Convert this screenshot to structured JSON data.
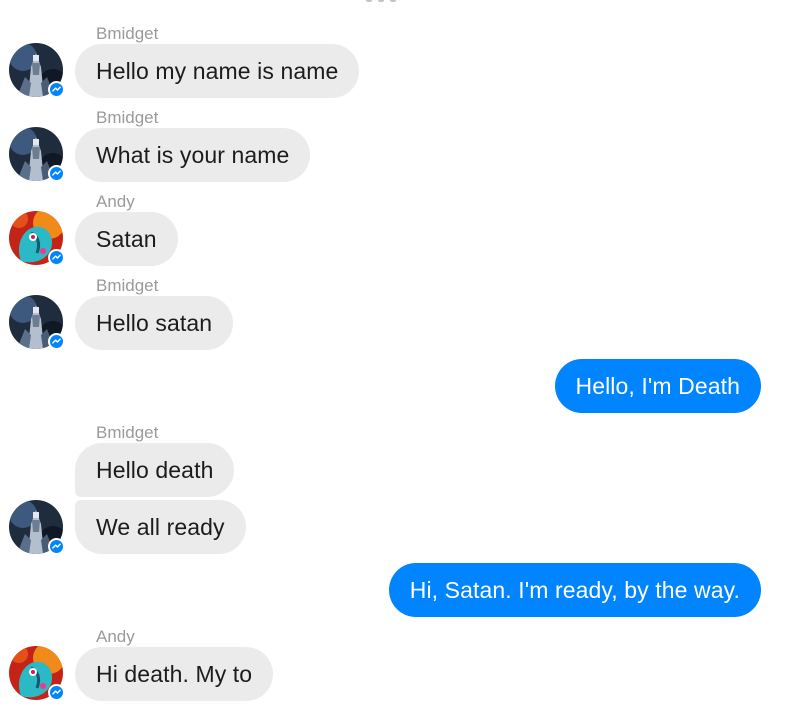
{
  "conversation": {
    "messages": [
      {
        "sender": "Bmidget",
        "text": "Hello my name is name"
      },
      {
        "sender": "Bmidget",
        "text": "What is your name"
      },
      {
        "sender": "Andy",
        "text": "Satan"
      },
      {
        "sender": "Bmidget",
        "text": "Hello satan"
      },
      {
        "sender": "",
        "text": "Hello, I'm Death"
      },
      {
        "sender": "Bmidget",
        "text": "Hello death"
      },
      {
        "sender": "",
        "text": "We all ready"
      },
      {
        "sender": "",
        "text": "Hi, Satan. I'm ready, by the way."
      },
      {
        "sender": "Andy",
        "text": "Hi death. My to"
      }
    ]
  },
  "icons": {
    "avatar_bmidget": "dark-armored-figure-avatar",
    "avatar_andy": "red-fire-creature-avatar",
    "badge": "messenger-badge-icon"
  },
  "colors": {
    "outgoing_bubble": "#0084ff",
    "incoming_bubble": "#ebebeb",
    "sender_name": "#9a9a9a",
    "incoming_text": "#1c1c1c"
  }
}
